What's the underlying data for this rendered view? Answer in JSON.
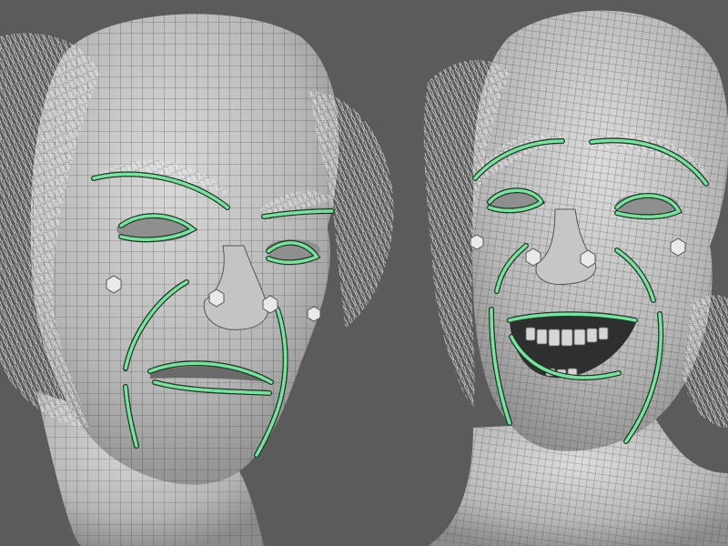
{
  "scene": {
    "background_color": "#5b5b5b",
    "skin_color": "#bdbdbd",
    "wire_color": "#3a3a3a",
    "hair_color": "#e6e6e6",
    "rig_curve_color": "#7de0a0",
    "rig_curve_outline": "#1c3a26",
    "control_cube_color": "#e9e9e9"
  },
  "heads": [
    {
      "id": "left",
      "expression": "angry-frown"
    },
    {
      "id": "right",
      "expression": "laughing"
    }
  ]
}
